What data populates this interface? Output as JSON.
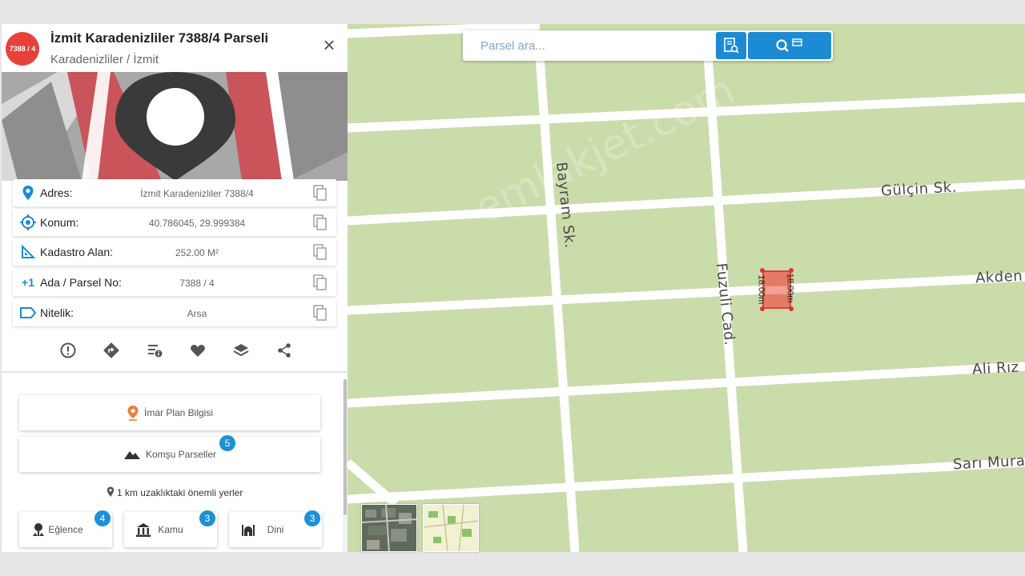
{
  "panel": {
    "badge": "7388 / 4",
    "title": "İzmit Karadenizliler 7388/4 Parseli",
    "subtitle": "Karadenizliler / İzmit",
    "close_symbol": "×",
    "info_rows": [
      {
        "label": "Adres:",
        "value": "İzmit Karadenizliler 7388/4",
        "icon": "location-pin-icon"
      },
      {
        "label": "Konum:",
        "value": "40.786045, 29.999384",
        "icon": "crosshair-icon"
      },
      {
        "label": "Kadastro Alan:",
        "value": "252.00 M²",
        "icon": "set-square-icon"
      },
      {
        "label": "Ada / Parsel No:",
        "value": "7388 / 4",
        "icon": "plus-one-icon"
      },
      {
        "label": "Nitelik:",
        "value": "Arsa",
        "icon": "tag-icon"
      }
    ],
    "plus_one_text": "+1",
    "actions": [
      "report-icon",
      "directions-icon",
      "details-icon",
      "favorite-icon",
      "layers-icon",
      "share-icon"
    ],
    "imar_button": "İmar Plan Bilgisi",
    "komsu_button": "Komşu Parseller",
    "komsu_count": "5",
    "nearby_text": "1 km uzaklıktaki önemli yerler",
    "categories": [
      {
        "label": "Eğlence",
        "count": "4",
        "icon": "entertainment-icon"
      },
      {
        "label": "Kamu",
        "count": "3",
        "icon": "government-building-icon"
      },
      {
        "label": "Dini",
        "count": "3",
        "icon": "mosque-icon"
      }
    ]
  },
  "search": {
    "placeholder": "Parsel ara..."
  },
  "map": {
    "streets": [
      "Bayram Sk.",
      "Fuzuli Cad.",
      "Gülçin Sk.",
      "Akden",
      "Ali Rız",
      "Sarı Mura"
    ],
    "parcel_dimensions": [
      "18.00m",
      "18.00m"
    ],
    "watermark": "emlakjet.com",
    "colors": {
      "land": "#cbdcab",
      "road": "#ffffff",
      "parcel_fill": "#e8735f",
      "parcel_stroke": "#d9382b",
      "accent": "#1d8ad4",
      "badge": "#e8403a"
    }
  }
}
